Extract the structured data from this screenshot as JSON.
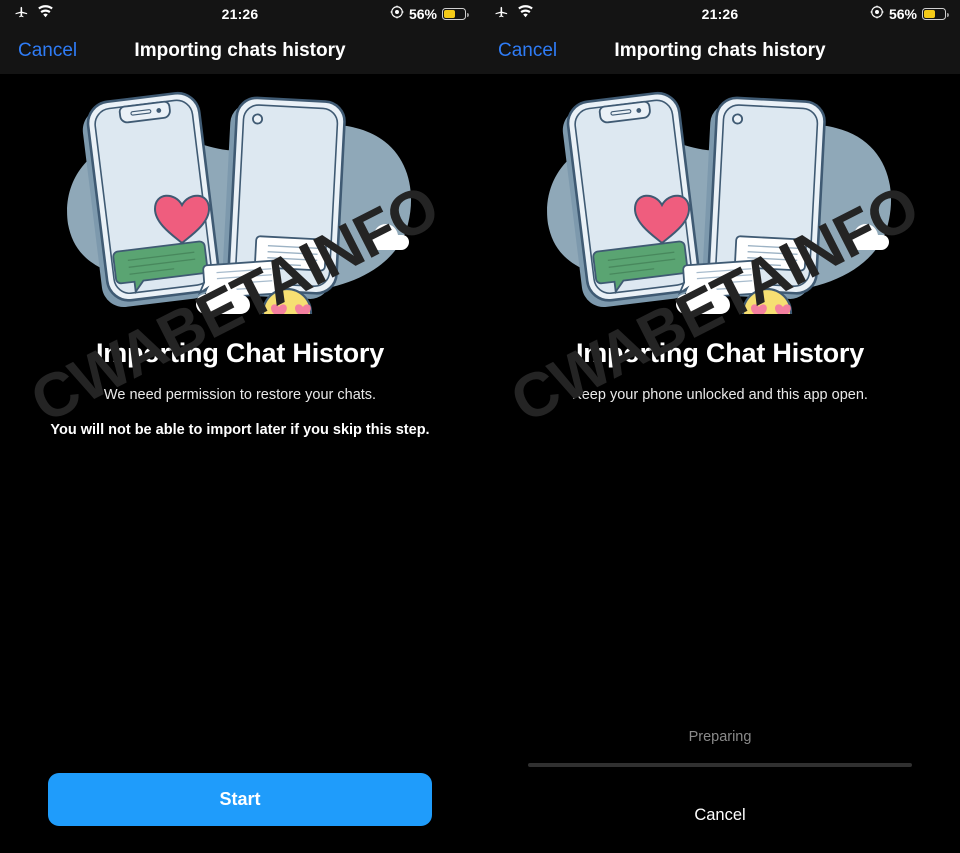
{
  "status_bar": {
    "airplane_icon": "airplane-icon",
    "wifi_icon": "wifi-icon",
    "time": "21:26",
    "location_icon": "location-services-icon",
    "battery_percent": "56%",
    "battery_level": 56,
    "battery_color": "#f5cb18"
  },
  "nav": {
    "cancel_label": "Cancel",
    "title": "Importing chats history",
    "accent_color": "#2f7cf6"
  },
  "watermark": {
    "text": "CWABETAINFO"
  },
  "illustration": {
    "name": "chat-transfer-illustration",
    "blob_color": "#8fa8b8",
    "phone_body_color": "#eaf1f7",
    "phone_outline_color": "#3f5a73",
    "phone_shadow_color": "#7d99ad",
    "heart_color": "#ef5d7e",
    "emoji_color": "#f6df72",
    "emoji_heart_color": "#f4809f",
    "green_bubble_color": "#5aa472",
    "cloud_color": "#ffffff",
    "bubble_color": "#ffffff"
  },
  "panels": [
    {
      "id": "permission-step",
      "headline": "Importing Chat History",
      "subline": "We need permission to restore your chats.",
      "warning": "You will not be able to import later if you skip this step.",
      "primary_button": "Start",
      "button_color": "#1f9cfb"
    },
    {
      "id": "progress-step",
      "headline": "Importing Chat History",
      "subline": "Keep your phone unlocked and this app open.",
      "progress_label": "Preparing",
      "progress_percent": 0,
      "cancel_label": "Cancel"
    }
  ]
}
